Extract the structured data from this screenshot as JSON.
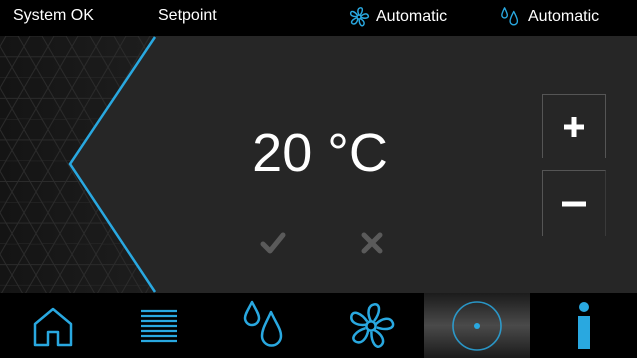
{
  "status_bar": {
    "system_status": "System OK",
    "screen_title": "Setpoint",
    "fan_mode": {
      "icon": "fan-icon",
      "label": "Automatic"
    },
    "humidity_mode": {
      "icon": "water-drops-icon",
      "label": "Automatic"
    }
  },
  "setpoint": {
    "value": "20 °C",
    "increase_icon": "plus-icon",
    "decrease_icon": "minus-icon",
    "confirm_icon": "checkmark-icon",
    "cancel_icon": "cross-icon"
  },
  "nav": {
    "items": [
      {
        "name": "home",
        "icon": "home-icon"
      },
      {
        "name": "menu",
        "icon": "list-icon"
      },
      {
        "name": "humidity",
        "icon": "water-drops-icon"
      },
      {
        "name": "fan",
        "icon": "fan-icon"
      },
      {
        "name": "setpoint",
        "icon": "dial-icon",
        "active": true
      },
      {
        "name": "info",
        "icon": "info-icon"
      }
    ]
  },
  "colors": {
    "accent": "#29a8e0",
    "panel_background": "#262626",
    "bar_background": "#000000",
    "disabled_icon": "#5a5a5a"
  }
}
